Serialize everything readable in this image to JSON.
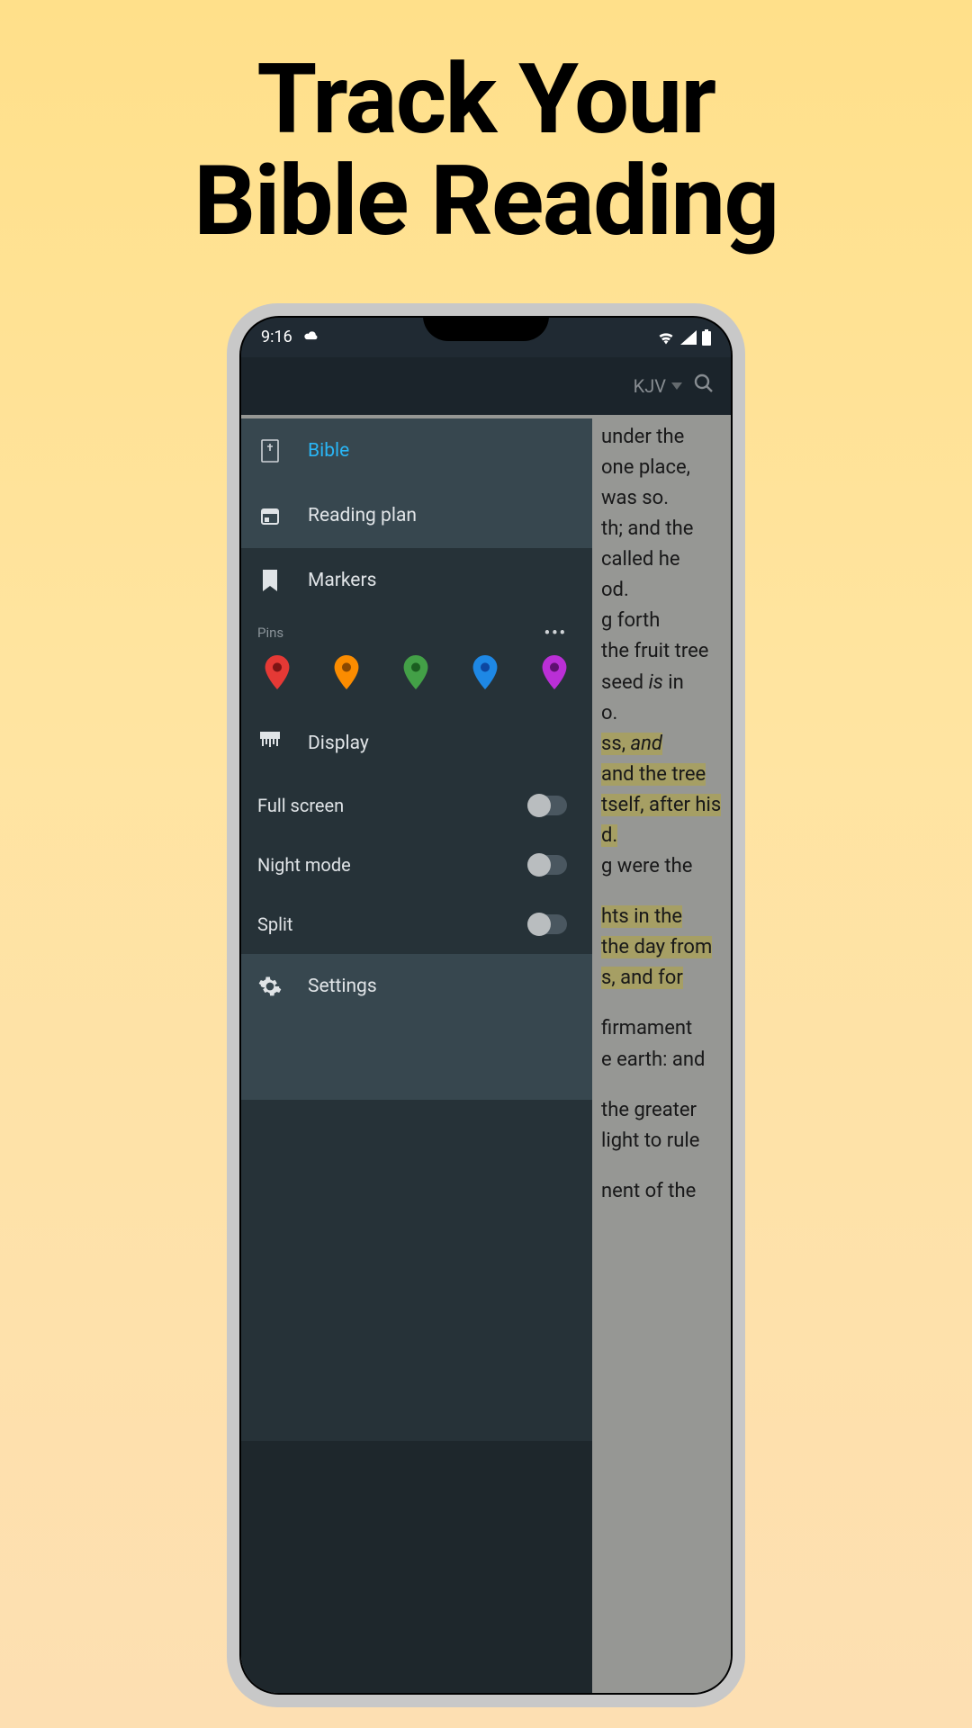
{
  "headline_line1": "Track Your",
  "headline_line2": "Bible Reading",
  "status": {
    "time": "9:16"
  },
  "header": {
    "version": "KJV"
  },
  "drawer": {
    "bible": "Bible",
    "reading_plan": "Reading plan",
    "markers": "Markers",
    "pins_label": "Pins",
    "display": "Display",
    "full_screen": "Full screen",
    "night_mode": "Night mode",
    "split": "Split",
    "settings": "Settings",
    "pin_colors": [
      "#e53935",
      "#fb8c00",
      "#43a047",
      "#1e88e5",
      "#ba2fd6"
    ]
  },
  "bg_text": {
    "l1": "under the",
    "l2": "one place,",
    "l3": "was so.",
    "l4": "th; and the",
    "l5": "called he",
    "l6": "od.",
    "l7": "g forth",
    "l8": "the fruit tree",
    "l9a": " seed ",
    "l9b": "is",
    "l9c": " in",
    "l10": "o.",
    "l11a": "ss, ",
    "l11b": "and",
    "l12": "and the tree",
    "l13": "tself, after his",
    "l14": "d.",
    "l15": "g were the",
    "l16": "hts in the",
    "l17": "the day from",
    "l18": "s, and for",
    "l19": "firmament",
    "l20": "e earth: and",
    "l21": "the greater",
    "l22": " light to rule",
    "l23": "nent of the"
  }
}
